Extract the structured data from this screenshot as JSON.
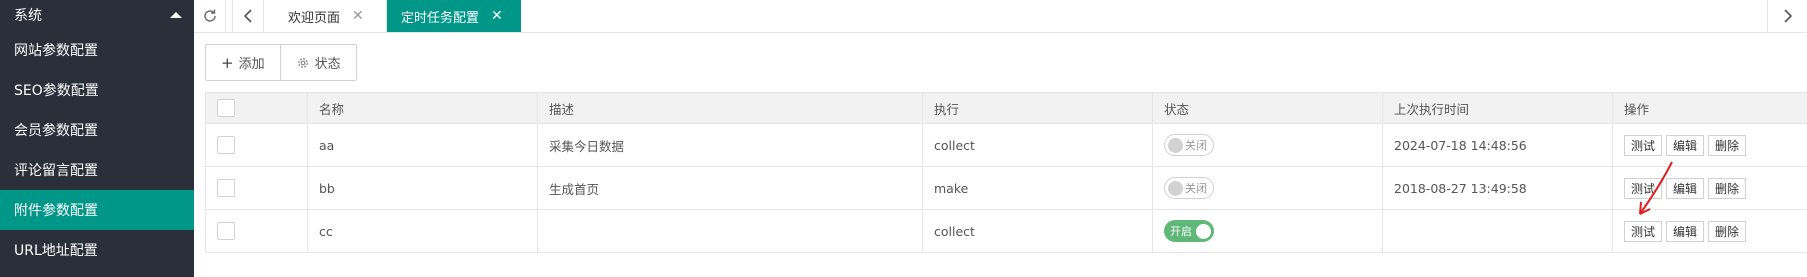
{
  "sidebar": {
    "section_title": "系统",
    "items": [
      {
        "label": "网站参数配置",
        "active": false
      },
      {
        "label": "SEO参数配置",
        "active": false
      },
      {
        "label": "会员参数配置",
        "active": false
      },
      {
        "label": "评论留言配置",
        "active": false
      },
      {
        "label": "附件参数配置",
        "active": true
      },
      {
        "label": "URL地址配置",
        "active": false
      }
    ]
  },
  "tabs": [
    {
      "label": "欢迎页面",
      "close": "✕"
    },
    {
      "label": "定时任务配置",
      "close": "✕"
    }
  ],
  "toolbar": {
    "add_label": "添加",
    "status_label": "状态"
  },
  "table": {
    "headers": [
      "",
      "名称",
      "描述",
      "执行",
      "状态",
      "上次执行时间",
      "操作"
    ],
    "rows": [
      {
        "name": "aa",
        "desc": "采集今日数据",
        "exec": "collect",
        "status": "关闭",
        "status_on": false,
        "last_run": "2024-07-18 14:48:56"
      },
      {
        "name": "bb",
        "desc": "生成首页",
        "exec": "make",
        "status": "关闭",
        "status_on": false,
        "last_run": "2018-08-27 13:49:58"
      },
      {
        "name": "cc",
        "desc": "",
        "exec": "collect",
        "status": "开启",
        "status_on": true,
        "last_run": ""
      }
    ],
    "actions": {
      "test": "测试",
      "edit": "编辑",
      "delete": "删除"
    }
  },
  "colors": {
    "accent": "#009688",
    "sidebar_bg": "#2b2f3a",
    "switch_on": "#5fb878",
    "annotation": "#e02020"
  }
}
